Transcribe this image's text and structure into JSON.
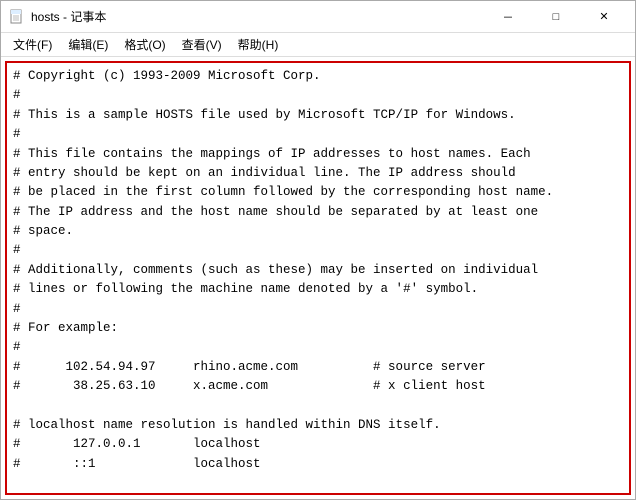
{
  "window": {
    "title": "hosts - 记事本",
    "title_icon": "📄"
  },
  "title_bar": {
    "title": "hosts - 记事本",
    "minimize_label": "－",
    "maximize_label": "□",
    "close_label": "✕"
  },
  "menu_bar": {
    "items": [
      {
        "label": "文件(F)"
      },
      {
        "label": "编辑(E)"
      },
      {
        "label": "格式(O)"
      },
      {
        "label": "查看(V)"
      },
      {
        "label": "帮助(H)"
      }
    ]
  },
  "editor": {
    "content": "# Copyright (c) 1993-2009 Microsoft Corp.\n#\n# This is a sample HOSTS file used by Microsoft TCP/IP for Windows.\n#\n# This file contains the mappings of IP addresses to host names. Each\n# entry should be kept on an individual line. The IP address should\n# be placed in the first column followed by the corresponding host name.\n# The IP address and the host name should be separated by at least one\n# space.\n#\n# Additionally, comments (such as these) may be inserted on individual\n# lines or following the machine name denoted by a '#' symbol.\n#\n# For example:\n#\n#      102.54.94.97     rhino.acme.com          # source server\n#       38.25.63.10     x.acme.com              # x client host\n\n# localhost name resolution is handled within DNS itself.\n#\t127.0.0.1       localhost\n#\t::1             localhost"
  }
}
